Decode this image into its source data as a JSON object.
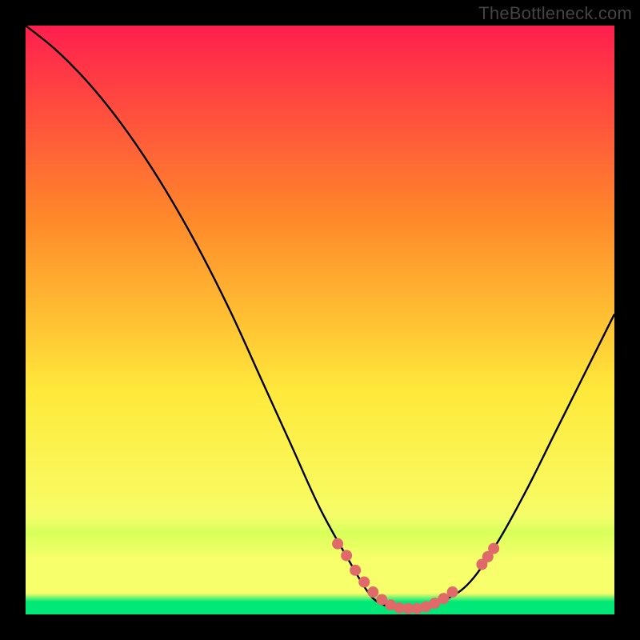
{
  "attribution": "TheBottleneck.com",
  "chart_data": {
    "type": "line",
    "title": "",
    "xlabel": "",
    "ylabel": "",
    "xlim": [
      0,
      100
    ],
    "ylim": [
      0,
      100
    ],
    "series": [
      {
        "name": "bottleneck-curve",
        "x": [
          0,
          5,
          10,
          15,
          20,
          25,
          30,
          35,
          40,
          45,
          50,
          55,
          58,
          60,
          63,
          66,
          70,
          75,
          80,
          85,
          90,
          95,
          100
        ],
        "y": [
          100,
          96,
          91,
          85,
          78,
          70,
          61,
          51,
          40,
          29,
          18,
          9,
          4,
          2,
          1,
          1,
          2,
          5,
          12,
          21,
          31,
          41,
          51
        ]
      }
    ],
    "markers": {
      "name": "highlight-dots",
      "color": "#e06a6a",
      "x": [
        53,
        54.5,
        56,
        57.5,
        59,
        60.5,
        62,
        63.5,
        65,
        66.5,
        68,
        69.5,
        71,
        72.5,
        77.5,
        78.5,
        79.5
      ],
      "y": [
        12,
        10,
        7.5,
        5.5,
        3.8,
        2.5,
        1.6,
        1.1,
        1,
        1,
        1.3,
        1.9,
        2.7,
        3.8,
        8.5,
        9.8,
        11.2
      ]
    },
    "background": {
      "gradient_top": "#ff1f4f",
      "gradient_mid1": "#ff8a2a",
      "gradient_mid2": "#ffe93b",
      "gradient_low": "#f7ff6a",
      "band_upper": "#d8ff5a",
      "band_green": "#00e878",
      "frame": "#000000"
    }
  }
}
